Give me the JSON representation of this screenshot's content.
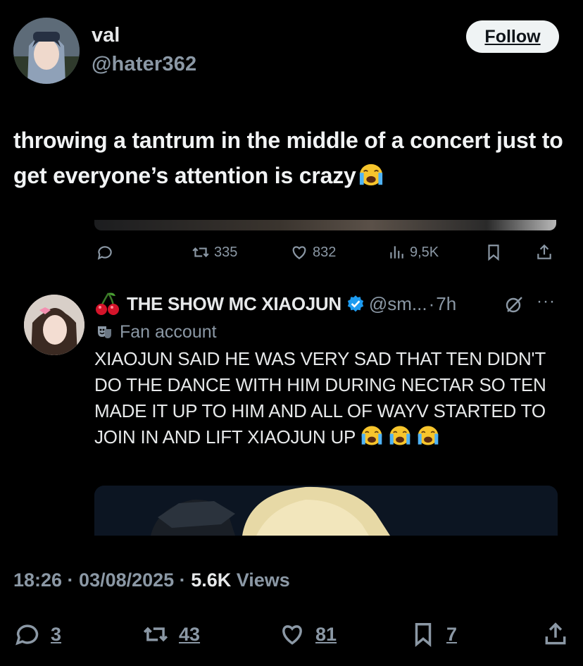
{
  "tweet": {
    "author": {
      "display_name": "val",
      "handle": "@hater362",
      "avatar_icon": "profile-avatar"
    },
    "follow_label": "Follow",
    "text": "throwing a tantrum in the middle of a concert just to get everyone’s attention is crazy",
    "text_emoji": "loudly-crying-face",
    "timestamp": "18:26 · 03/08/2025 · ",
    "views_count": "5.6K",
    "views_label": " Views",
    "stats": {
      "replies": "3",
      "retweets": "43",
      "likes": "81",
      "bookmarks": "7"
    }
  },
  "quoted_actions": {
    "retweets": "335",
    "likes": "832",
    "views": "9,5K"
  },
  "reply": {
    "name": "THE SHOW MC XIAOJUN",
    "name_prefix_icon": "cherries-emoji",
    "verified": true,
    "handle": "@sm...",
    "separator": "·",
    "time": "7h",
    "more": "···",
    "fan_label": "Fan account",
    "body": "XIAOJUN SAID HE WAS VERY SAD THAT TEN DIDN'T DO THE DANCE WITH HIM DURING NECTAR SO TEN MADE IT UP TO HIM AND ALL OF WAYV STARTED TO JOIN IN AND LIFT XIAOJUN UP",
    "body_emoji_count": 3
  },
  "colors": {
    "background": "#000000",
    "text": "#e7e9ea",
    "secondary": "#8b98a5",
    "verified": "#1d9bf0",
    "follow_bg": "#eff3f4",
    "emoji": "#f7c52c"
  }
}
